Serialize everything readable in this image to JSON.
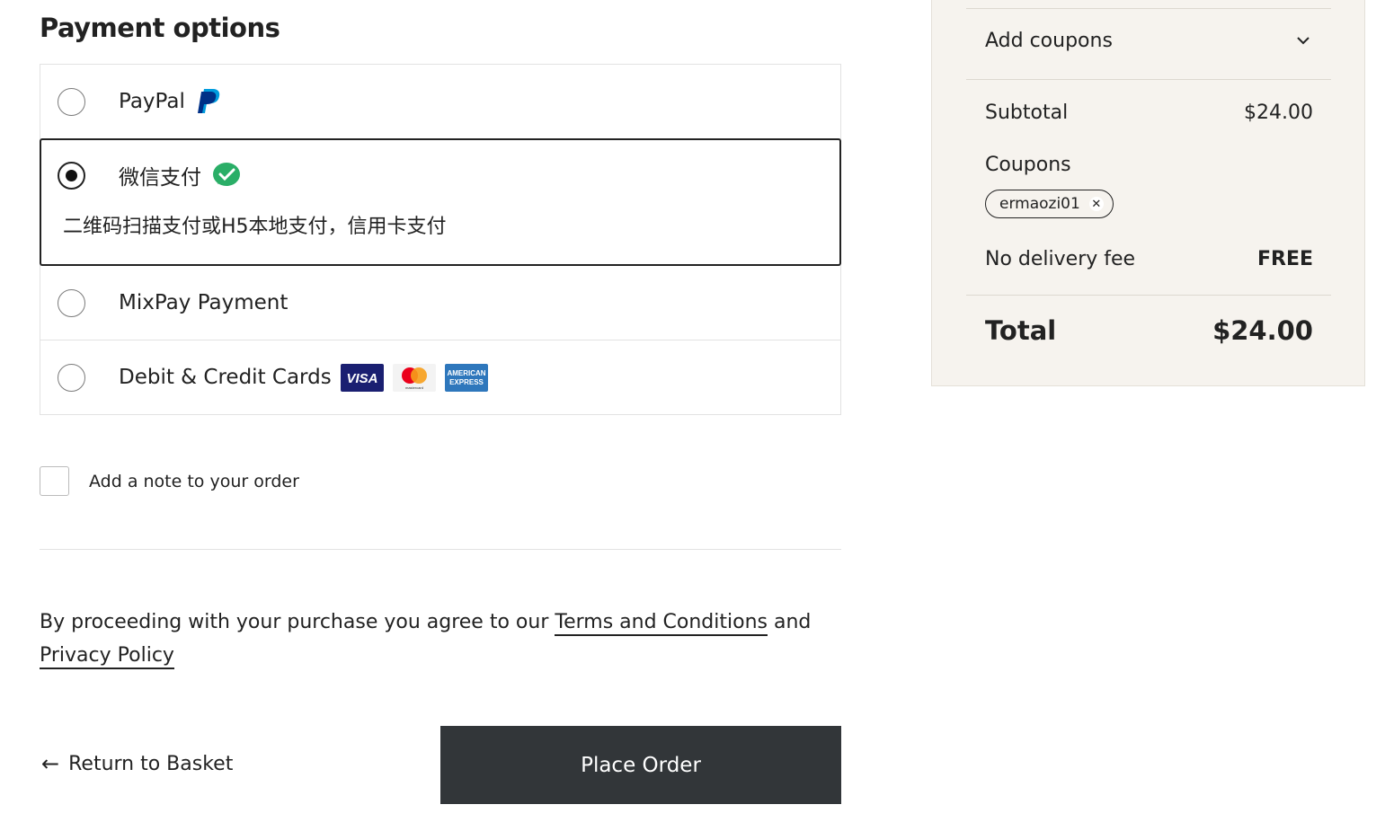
{
  "payment": {
    "title": "Payment options",
    "options": [
      {
        "label": "PayPal",
        "logo": "paypal-logo",
        "selected": false
      },
      {
        "label": "微信支付",
        "logo": "wechat-pay-logo",
        "selected": true,
        "description": "二维码扫描支付或H5本地支付，信用卡支付"
      },
      {
        "label": "MixPay Payment",
        "selected": false
      },
      {
        "label": "Debit & Credit Cards",
        "logos": [
          "visa-logo",
          "mastercard-logo",
          "amex-logo"
        ],
        "selected": false
      }
    ]
  },
  "logos": {
    "visa": "VISA",
    "mastercard": "mastercard",
    "amex_line1": "AMERICAN",
    "amex_line2": "EXPRESS"
  },
  "note": {
    "label": "Add a note to your order",
    "checked": false
  },
  "terms": {
    "prefix": "By proceeding with your purchase you agree to our",
    "terms_link": "Terms and Conditions",
    "joiner": "and",
    "privacy_link": "Privacy Policy"
  },
  "actions": {
    "return_label": "Return to Basket",
    "place_order_label": "Place Order"
  },
  "summary": {
    "add_coupons_label": "Add coupons",
    "subtotal_label": "Subtotal",
    "subtotal_value": "$24.00",
    "coupons_label": "Coupons",
    "coupon_code": "ermaozi01",
    "delivery_label": "No delivery fee",
    "delivery_value": "FREE",
    "total_label": "Total",
    "total_value": "$24.00"
  },
  "colors": {
    "place_order_bg": "#323639",
    "summary_bg": "#f6f3ee",
    "paypal_blue": "#003087",
    "paypal_light": "#009cde",
    "wechat_green": "#2aae67",
    "visa_blue": "#1a1f71",
    "amex_blue": "#2e77bc"
  }
}
